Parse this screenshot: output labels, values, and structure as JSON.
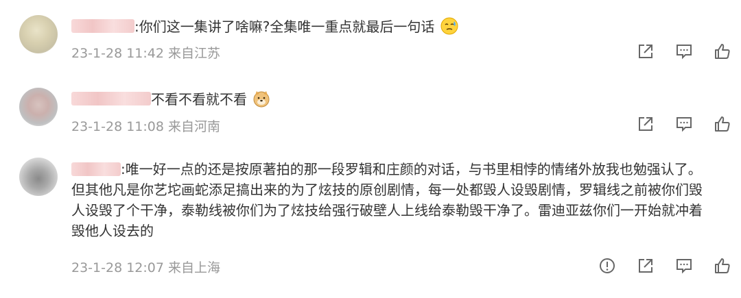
{
  "comments": [
    {
      "text": ":你们这一集讲了啥嘛?全集唯一重点就最后一句话",
      "emoji_icon": "cold-sweat-emoji",
      "time": "23-1-28 11:42",
      "location": "来自江苏",
      "actions": [
        "share-icon",
        "comment-icon",
        "like-icon"
      ]
    },
    {
      "text": "不看不看就不看",
      "emoji_icon": "doge-emoji",
      "time": "23-1-28 11:08",
      "location": "来自河南",
      "actions": [
        "share-icon",
        "comment-icon",
        "like-icon"
      ]
    },
    {
      "lines": [
        ":唯一好一点的还是按原著拍的那一段罗辑和庄颜的对话，与书里相悖的情绪外放我也勉强认了。",
        "但其他凡是你艺坨画蛇添足搞出来的为了炫技的原创剧情，每一处都毁人设毁剧情，罗辑线之前被你们毁",
        "人设毁了个干净，泰勒线被你们为了炫技给强行破壁人上线给泰勒毁干净了。雷迪亚兹你们一开始就冲着",
        "毁他人设去的"
      ],
      "time": "23-1-28 12:07",
      "location": "来自上海",
      "actions": [
        "report-icon",
        "share-icon",
        "comment-icon",
        "like-icon"
      ]
    }
  ]
}
